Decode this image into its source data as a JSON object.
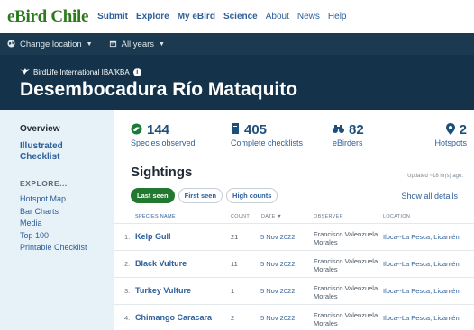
{
  "nav": {
    "brand_part1": "eBird",
    "brand_part2": "Chile",
    "items": [
      {
        "label": "Submit",
        "bold": true
      },
      {
        "label": "Explore",
        "bold": true
      },
      {
        "label": "My eBird",
        "bold": true
      },
      {
        "label": "Science",
        "bold": true
      },
      {
        "label": "About",
        "bold": false
      },
      {
        "label": "News",
        "bold": false
      },
      {
        "label": "Help",
        "bold": false
      }
    ]
  },
  "locbar": {
    "change_location": "Change location",
    "years": "All years"
  },
  "hero": {
    "subtitle": "BirdLife International IBA/KBA",
    "title": "Desembocadura Río Mataquito"
  },
  "sidebar": {
    "overview": "Overview",
    "illustrated_checklist": "Illustrated Checklist",
    "explore_heading": "EXPLORE...",
    "links": [
      "Hotspot Map",
      "Bar Charts",
      "Media",
      "Top 100",
      "Printable Checklist"
    ]
  },
  "stats": {
    "species": {
      "value": "144",
      "label": "Species observed"
    },
    "checklists": {
      "value": "405",
      "label": "Complete checklists"
    },
    "ebirders": {
      "value": "82",
      "label": "eBirders"
    },
    "hotspots": {
      "value": "2",
      "label": "Hotspots"
    }
  },
  "sightings": {
    "title": "Sightings",
    "updated": "Updated ~18 hr(s) ago.",
    "filters": [
      "Last seen",
      "First seen",
      "High counts"
    ],
    "show_all": "Show all details",
    "headers": {
      "species": "SPECIES NAME",
      "count": "COUNT",
      "date": "DATE ▼",
      "observer": "OBSERVER",
      "location": "LOCATION"
    },
    "rows": [
      {
        "num": "1.",
        "species": "Kelp Gull",
        "count": "21",
        "date": "5 Nov 2022",
        "observer": "Francisco Valenzuela Morales",
        "location": "Iloca--La Pesca, Licantén"
      },
      {
        "num": "2.",
        "species": "Black Vulture",
        "count": "11",
        "date": "5 Nov 2022",
        "observer": "Francisco Valenzuela Morales",
        "location": "Iloca--La Pesca, Licantén"
      },
      {
        "num": "3.",
        "species": "Turkey Vulture",
        "count": "1",
        "date": "5 Nov 2022",
        "observer": "Francisco Valenzuela Morales",
        "location": "Iloca--La Pesca, Licantén"
      },
      {
        "num": "4.",
        "species": "Chimango Caracara",
        "count": "2",
        "date": "5 Nov 2022",
        "observer": "Francisco Valenzuela Morales",
        "location": "Iloca--La Pesca, Licantén"
      }
    ]
  }
}
